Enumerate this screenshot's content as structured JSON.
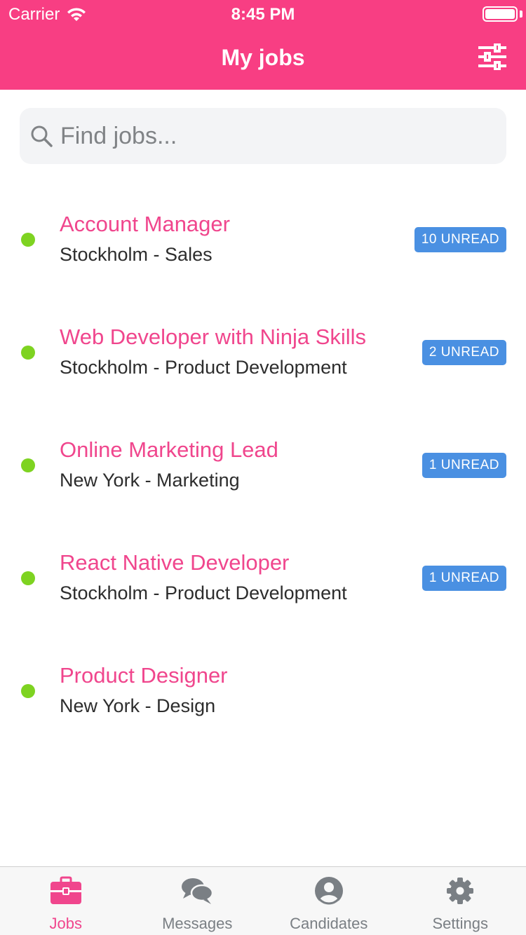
{
  "status_bar": {
    "carrier": "Carrier",
    "time": "8:45 PM"
  },
  "header": {
    "title": "My jobs"
  },
  "search": {
    "placeholder": "Find jobs..."
  },
  "jobs": [
    {
      "title": "Account Manager",
      "subtitle": "Stockholm - Sales",
      "badge": "10 UNREAD"
    },
    {
      "title": "Web Developer with Ninja Skills",
      "subtitle": "Stockholm - Product Development",
      "badge": "2 UNREAD"
    },
    {
      "title": "Online Marketing Lead",
      "subtitle": "New York - Marketing",
      "badge": "1 UNREAD"
    },
    {
      "title": "React Native Developer",
      "subtitle": "Stockholm - Product Development",
      "badge": "1 UNREAD"
    },
    {
      "title": "Product Designer",
      "subtitle": "New York - Design",
      "badge": ""
    }
  ],
  "tabs": [
    {
      "label": "Jobs",
      "icon": "briefcase-icon",
      "active": true
    },
    {
      "label": "Messages",
      "icon": "chat-bubbles-icon",
      "active": false
    },
    {
      "label": "Candidates",
      "icon": "person-icon",
      "active": false
    },
    {
      "label": "Settings",
      "icon": "gear-icon",
      "active": false
    }
  ],
  "colors": {
    "accent": "#F83E83",
    "title_pink": "#F0468D",
    "badge_blue": "#4A90E2",
    "status_green": "#7ED321"
  }
}
